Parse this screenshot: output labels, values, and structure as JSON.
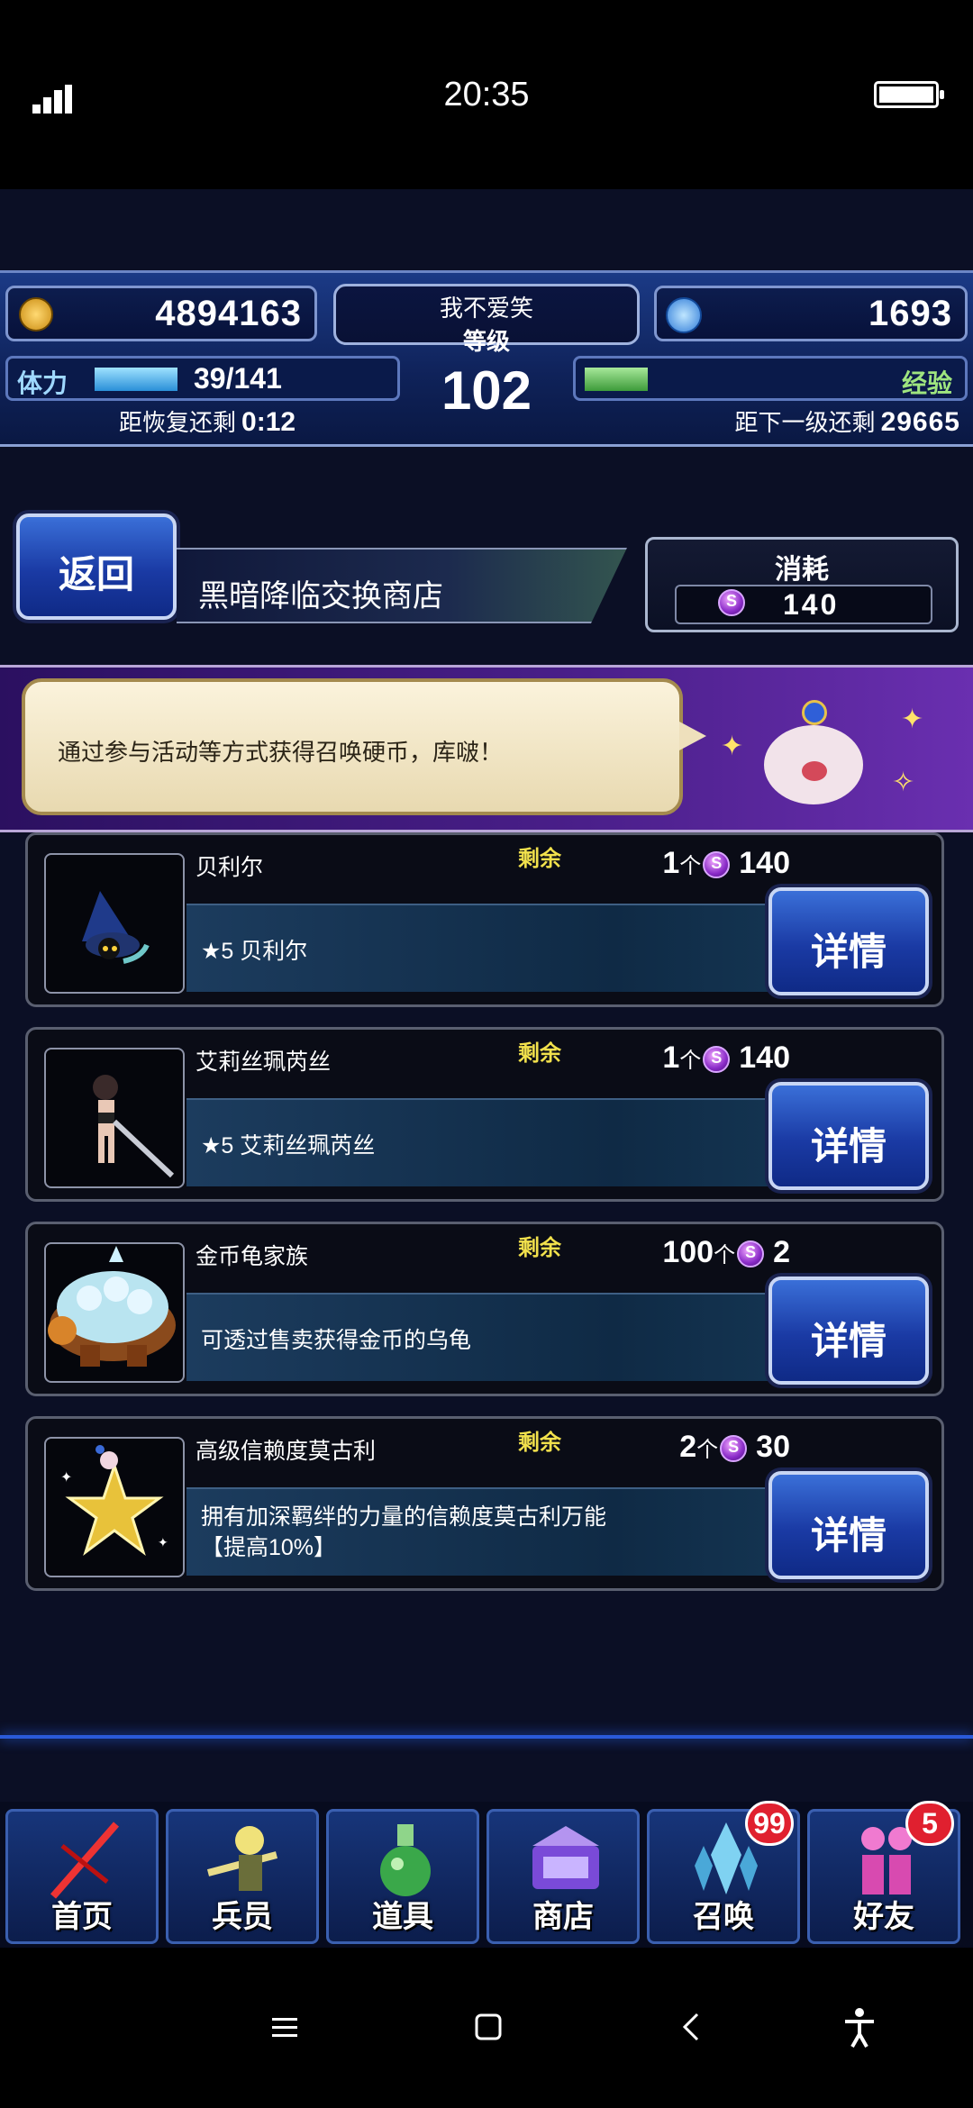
{
  "status_bar": {
    "time": "20:35"
  },
  "header": {
    "gil": "4894163",
    "gems": "1693",
    "player_name": "我不爱笑",
    "level_label": "等级",
    "level": "102",
    "stamina_label": "体力",
    "stamina": "39/141",
    "stamina_fill": 0.28,
    "recover_label": "距恢复还剩",
    "recover_time": "0:12",
    "exp_label": "经验",
    "exp_fill": 0.12,
    "next_level_label": "距下一级还剩",
    "next_level_value": "29665"
  },
  "shop": {
    "back_label": "返回",
    "title": "黑暗降临交换商店",
    "cost_label": "消耗",
    "cost_value": "140"
  },
  "banner": {
    "message": "通过参与活动等方式获得召唤硬币，库啵！"
  },
  "items": [
    {
      "name": "贝利尔",
      "remain_label": "剩余",
      "qty": "1",
      "unit": "个",
      "price": "140",
      "desc": "★5 贝利尔",
      "detail_label": "详情"
    },
    {
      "name": "艾莉丝珮芮丝",
      "remain_label": "剩余",
      "qty": "1",
      "unit": "个",
      "price": "140",
      "desc": "★5 艾莉丝珮芮丝",
      "detail_label": "详情"
    },
    {
      "name": "金币龟家族",
      "remain_label": "剩余",
      "qty": "100",
      "unit": "个",
      "price": "2",
      "desc": "可透过售卖获得金币的乌龟",
      "detail_label": "详情"
    },
    {
      "name": "高级信赖度莫古利",
      "remain_label": "剩余",
      "qty": "2",
      "unit": "个",
      "price": "30",
      "desc": "拥有加深羁绊的力量的信赖度莫古利万能\n【提高10%】",
      "detail_label": "详情"
    }
  ],
  "nav": [
    {
      "label": "首页",
      "icon": "sword-icon"
    },
    {
      "label": "兵员",
      "icon": "soldier-icon"
    },
    {
      "label": "道具",
      "icon": "potion-icon"
    },
    {
      "label": "商店",
      "icon": "shop-icon"
    },
    {
      "label": "召唤",
      "icon": "crystal-icon",
      "badge": "99"
    },
    {
      "label": "好友",
      "icon": "friends-icon",
      "badge": "5"
    }
  ],
  "colors": {
    "accent_blue": "#1a3aa4",
    "remain_yellow": "#f2e14c",
    "badge_red": "#e0202f"
  }
}
